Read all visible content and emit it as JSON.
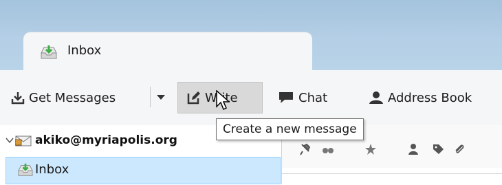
{
  "tab": {
    "label": "Inbox",
    "icon": "inbox-icon"
  },
  "toolbar": {
    "get_messages": "Get Messages",
    "write": "Write",
    "chat": "Chat",
    "address_book": "Address Book"
  },
  "folders": {
    "account": "akiko@myriapolis.org",
    "inbox": "Inbox"
  },
  "tooltip": {
    "text": "Create a new message"
  },
  "colors": {
    "titlebar": "#b4cfe6",
    "selection": "#cce8ff",
    "icon_dark": "#333333",
    "inbox_green": "#3fae49"
  }
}
